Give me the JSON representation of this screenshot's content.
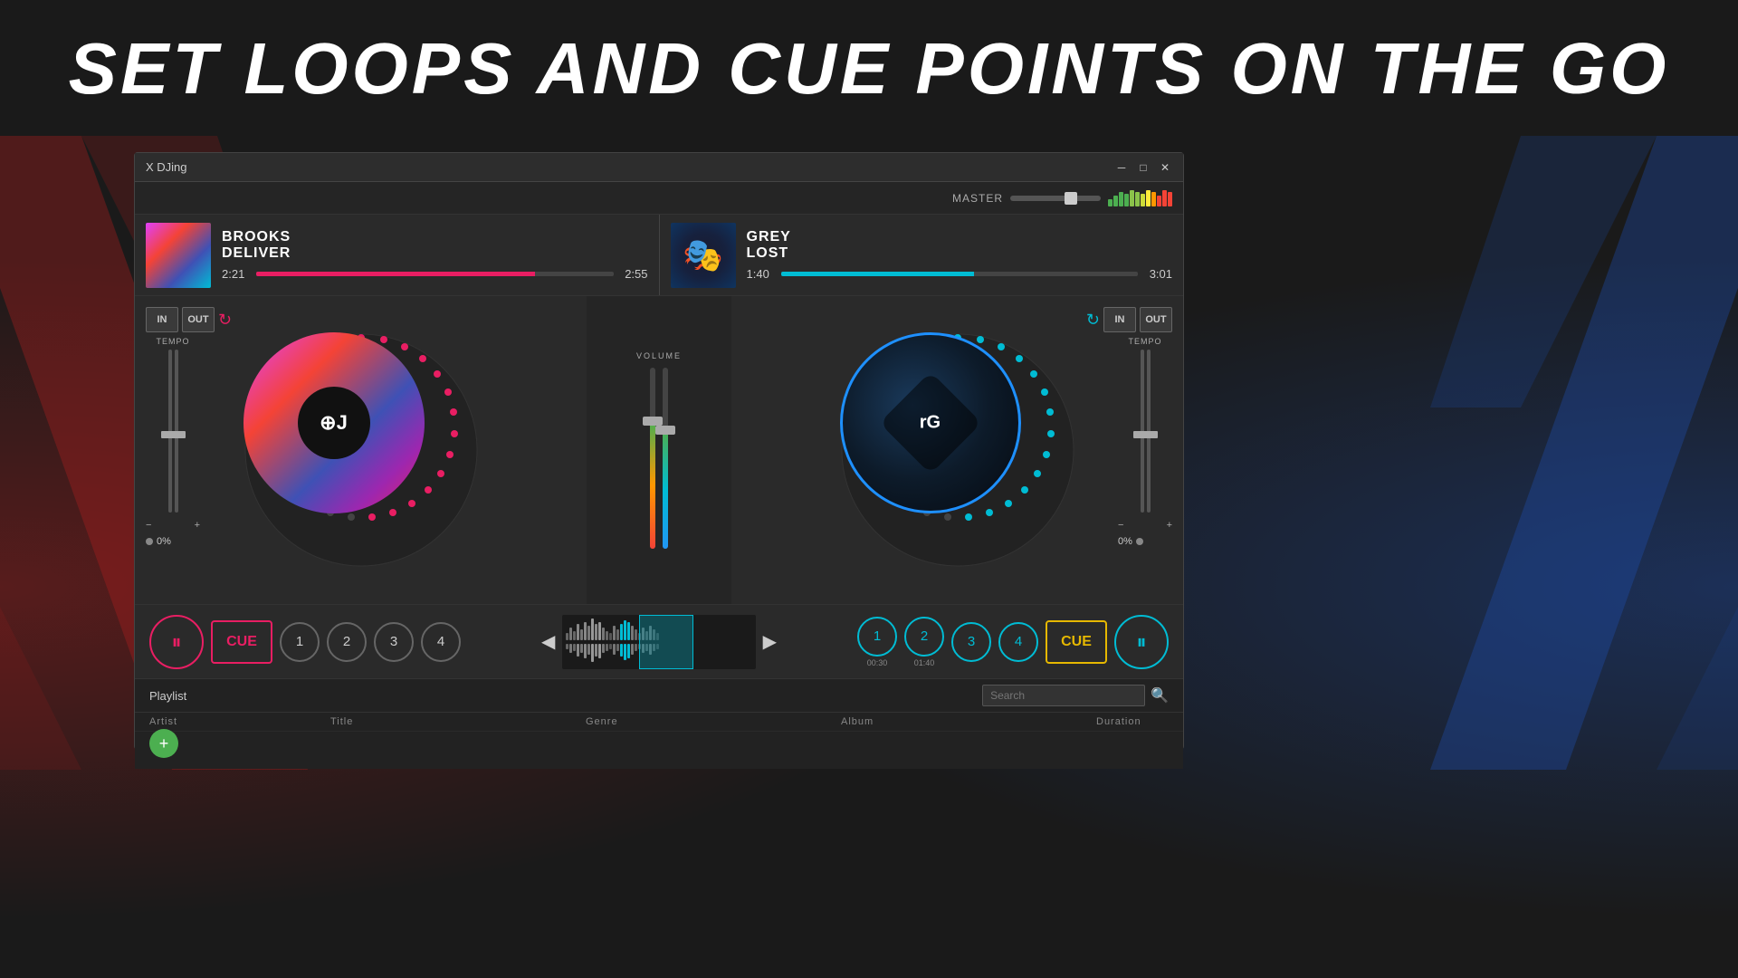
{
  "header": {
    "title": "SET LOOPS AND CUE POINTS ON THE GO"
  },
  "app": {
    "title": "X DJing",
    "master_label": "MASTER"
  },
  "deck_left": {
    "artist": "BROOKS",
    "track": "DELIVER",
    "current_time": "2:21",
    "total_time": "2:55",
    "progress_pct": 78,
    "tempo_label": "TEMPO",
    "tempo_pct": "0%",
    "loop_in": "IN",
    "loop_out": "OUT"
  },
  "deck_right": {
    "artist": "GREY",
    "track": "LOST",
    "current_time": "1:40",
    "total_time": "3:01",
    "progress_pct": 54,
    "tempo_label": "TEMPO",
    "tempo_pct": "0%",
    "loop_in": "IN",
    "loop_out": "OUT"
  },
  "volume": {
    "label": "VOLUME"
  },
  "controls_left": {
    "pause_label": "⏸",
    "cue_label": "CUE",
    "num1": "1",
    "num2": "2",
    "num3": "3",
    "num4": "4"
  },
  "controls_right": {
    "cue_label": "CUE",
    "pause_label": "⏸",
    "num1": "1",
    "num2": "2",
    "num3": "3",
    "num4": "4",
    "cue1_time": "00:30",
    "cue2_time": "01:40"
  },
  "playlist": {
    "title": "Playlist",
    "search_placeholder": "Search",
    "col_artist": "Artist",
    "col_title": "Title",
    "col_genre": "Genre",
    "col_album": "Album",
    "col_duration": "Duration",
    "add_label": "+"
  }
}
